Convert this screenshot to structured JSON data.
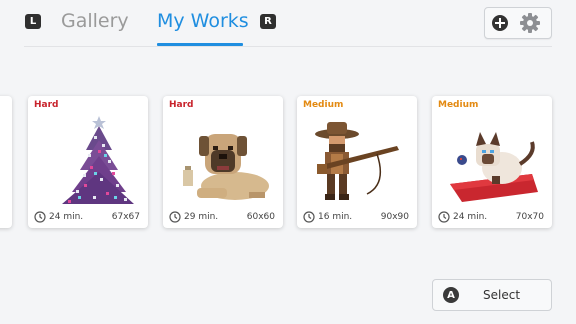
{
  "header": {
    "left_key": "L",
    "right_key": "R",
    "tabs": [
      {
        "label": "Gallery",
        "active": false
      },
      {
        "label": "My Works",
        "active": true
      }
    ],
    "toolbar": {
      "add_icon": "plus-circle-icon",
      "settings_icon": "gear-icon"
    }
  },
  "cards": [
    {
      "difficulty": "Hard",
      "art": "christmas-tree",
      "time": "24 min.",
      "size": "67x67"
    },
    {
      "difficulty": "Hard",
      "art": "mastiff-dog",
      "time": "29 min.",
      "size": "60x60"
    },
    {
      "difficulty": "Medium",
      "art": "cowboy-with-rifle",
      "time": "16 min.",
      "size": "90x90"
    },
    {
      "difficulty": "Medium",
      "art": "siamese-cat-on-cushion",
      "time": "24 min.",
      "size": "70x70"
    }
  ],
  "footer": {
    "button_key": "A",
    "select_label": "Select"
  },
  "colors": {
    "accent": "#1f8ee0",
    "hard": "#c8232c",
    "medium": "#e38a12",
    "background": "#f4f5f7"
  }
}
